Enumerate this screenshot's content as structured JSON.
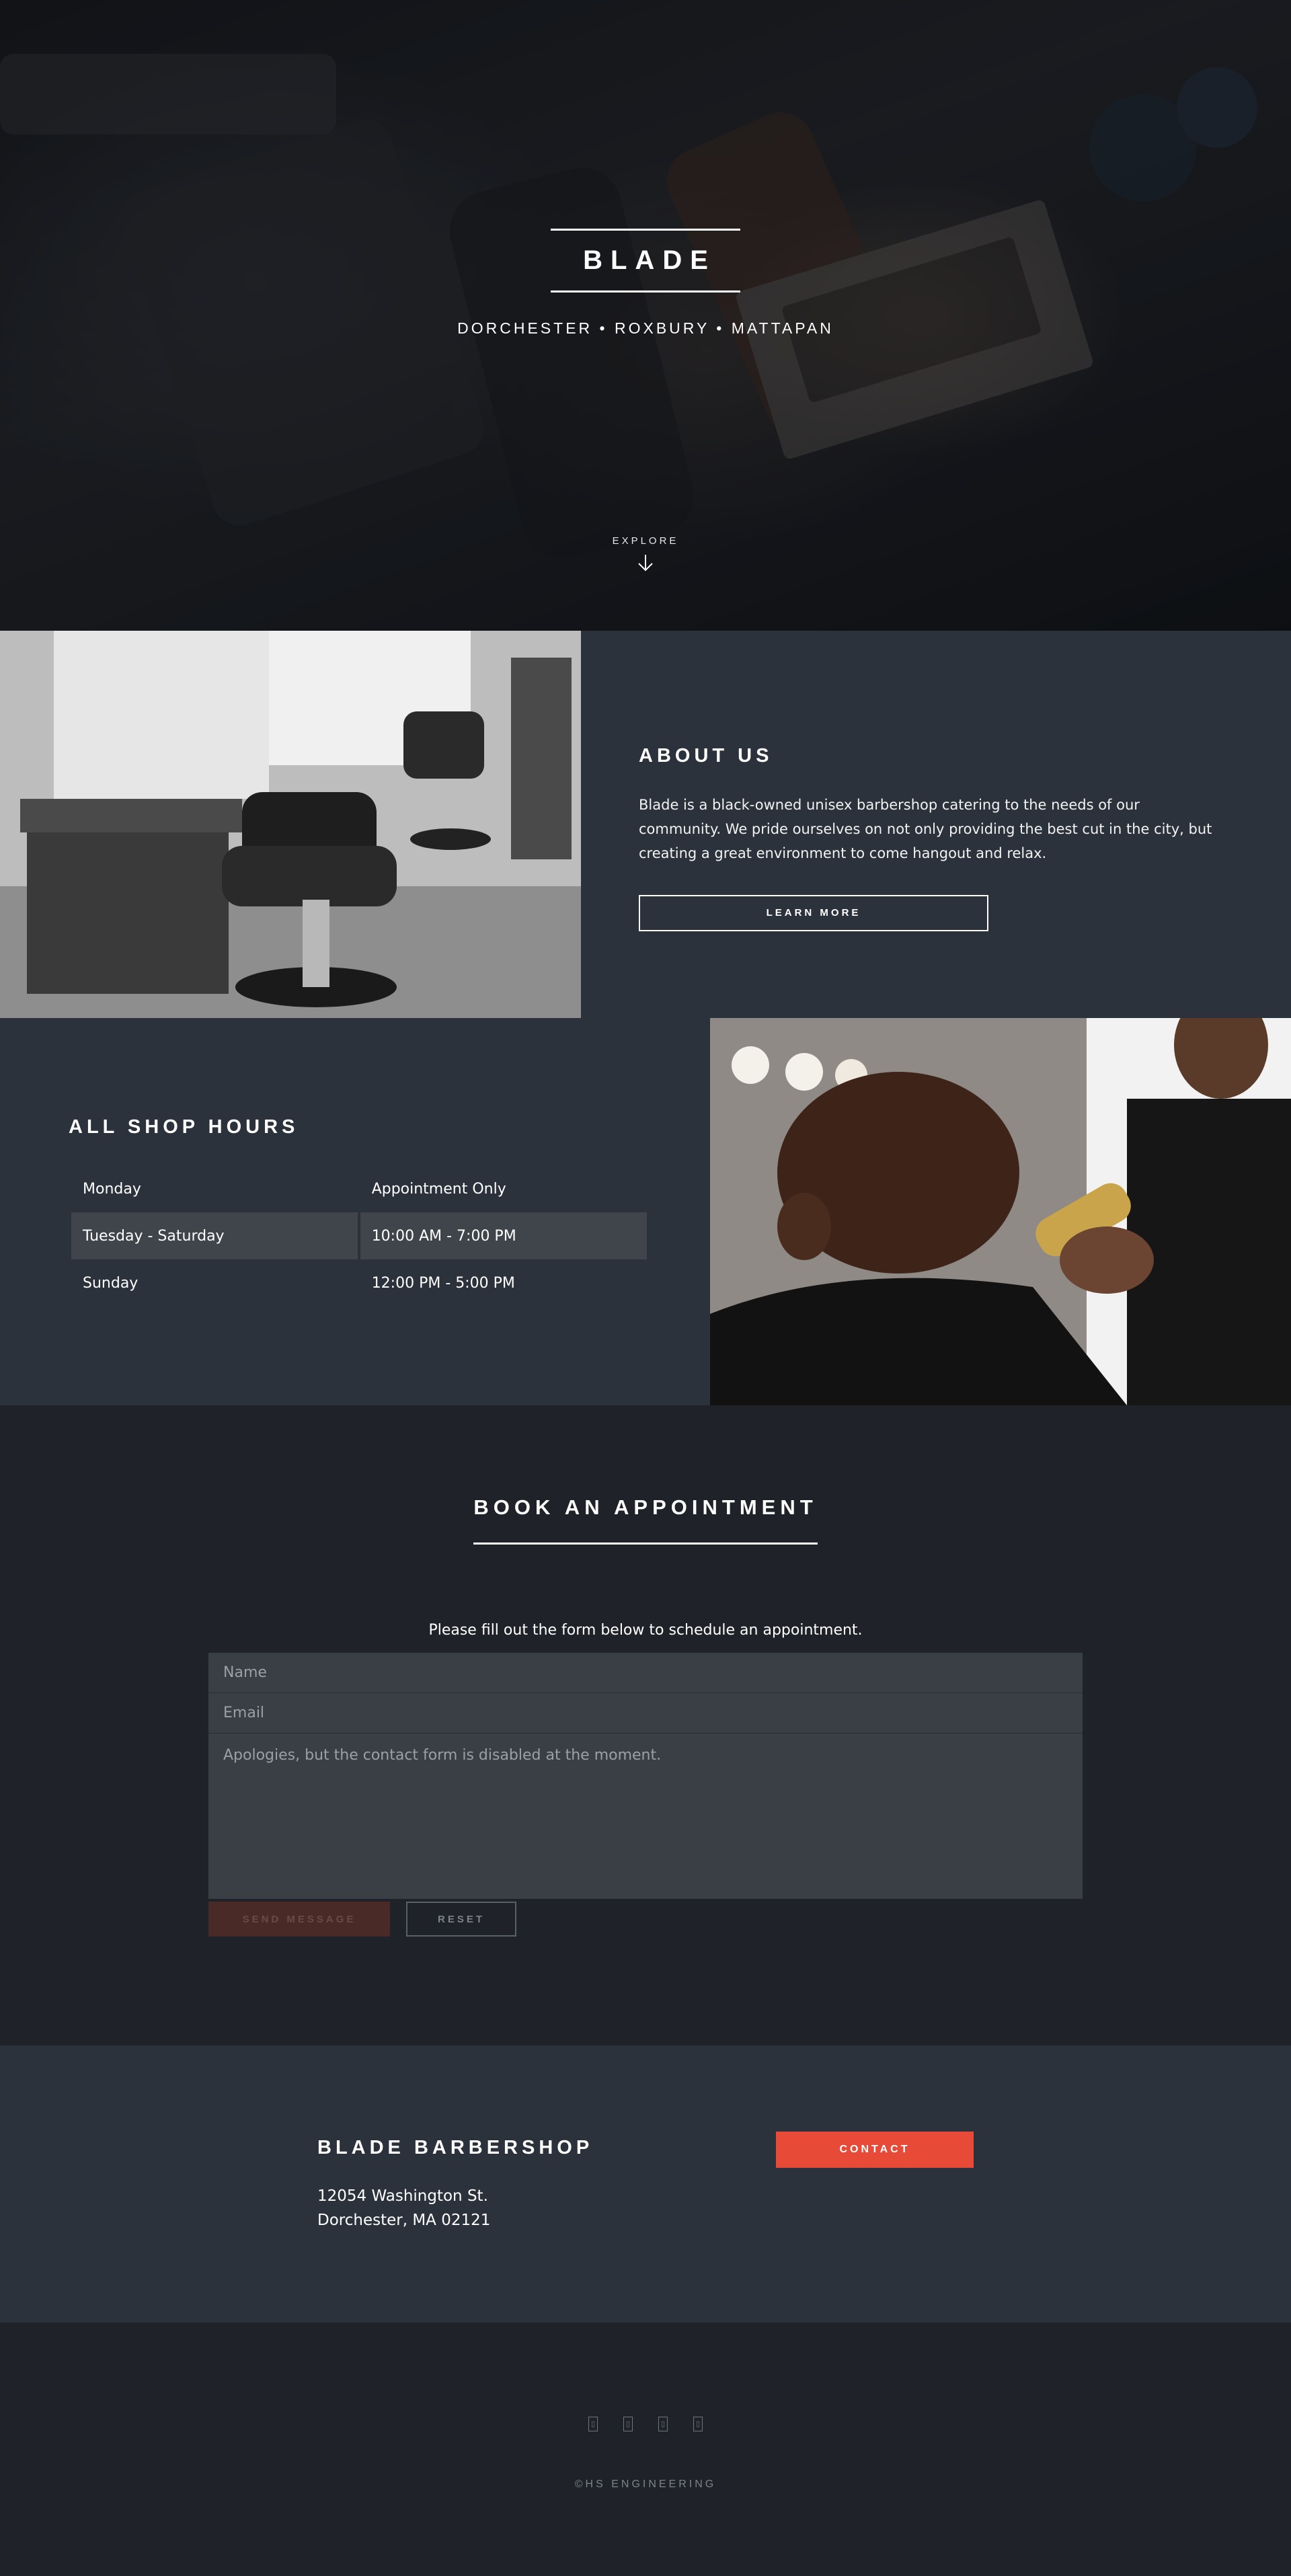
{
  "hero": {
    "brand": "BLADE",
    "locations": "DORCHESTER • ROXBURY • MATTAPAN",
    "explore_label": "EXPLORE"
  },
  "about": {
    "title": "ABOUT US",
    "body": "Blade is a black-owned unisex barbershop catering to the needs of our community. We pride ourselves on not only providing the best cut in the city, but creating a great environment to come hangout and relax.",
    "button_label": "LEARN MORE"
  },
  "hours": {
    "title": "ALL SHOP HOURS",
    "rows": [
      {
        "day": "Monday",
        "time": "Appointment Only"
      },
      {
        "day": "Tuesday - Saturday",
        "time": "10:00 AM - 7:00 PM"
      },
      {
        "day": "Sunday",
        "time": "12:00 PM - 5:00 PM"
      }
    ]
  },
  "booking": {
    "title": "BOOK AN APPOINTMENT",
    "intro": "Please fill out the form below to schedule an appointment.",
    "name_placeholder": "Name",
    "email_placeholder": "Email",
    "message_placeholder": "Apologies, but the contact form is disabled at the moment.",
    "send_label": "SEND MESSAGE",
    "reset_label": "RESET"
  },
  "contact": {
    "name": "BLADE BARBERSHOP",
    "address_line1": "12054 Washington St.",
    "address_line2": "Dorchester, MA 02121",
    "button_label": "CONTACT"
  },
  "footer": {
    "social_icons": [
      "twitter-icon",
      "facebook-icon",
      "instagram-icon",
      "email-icon"
    ],
    "copyright": "©HS ENGINEERING"
  },
  "colors": {
    "accent": "#e84a38",
    "dark_bg": "#1f2329",
    "panel_bg": "#2c323c",
    "field_bg": "#3a3f45"
  }
}
